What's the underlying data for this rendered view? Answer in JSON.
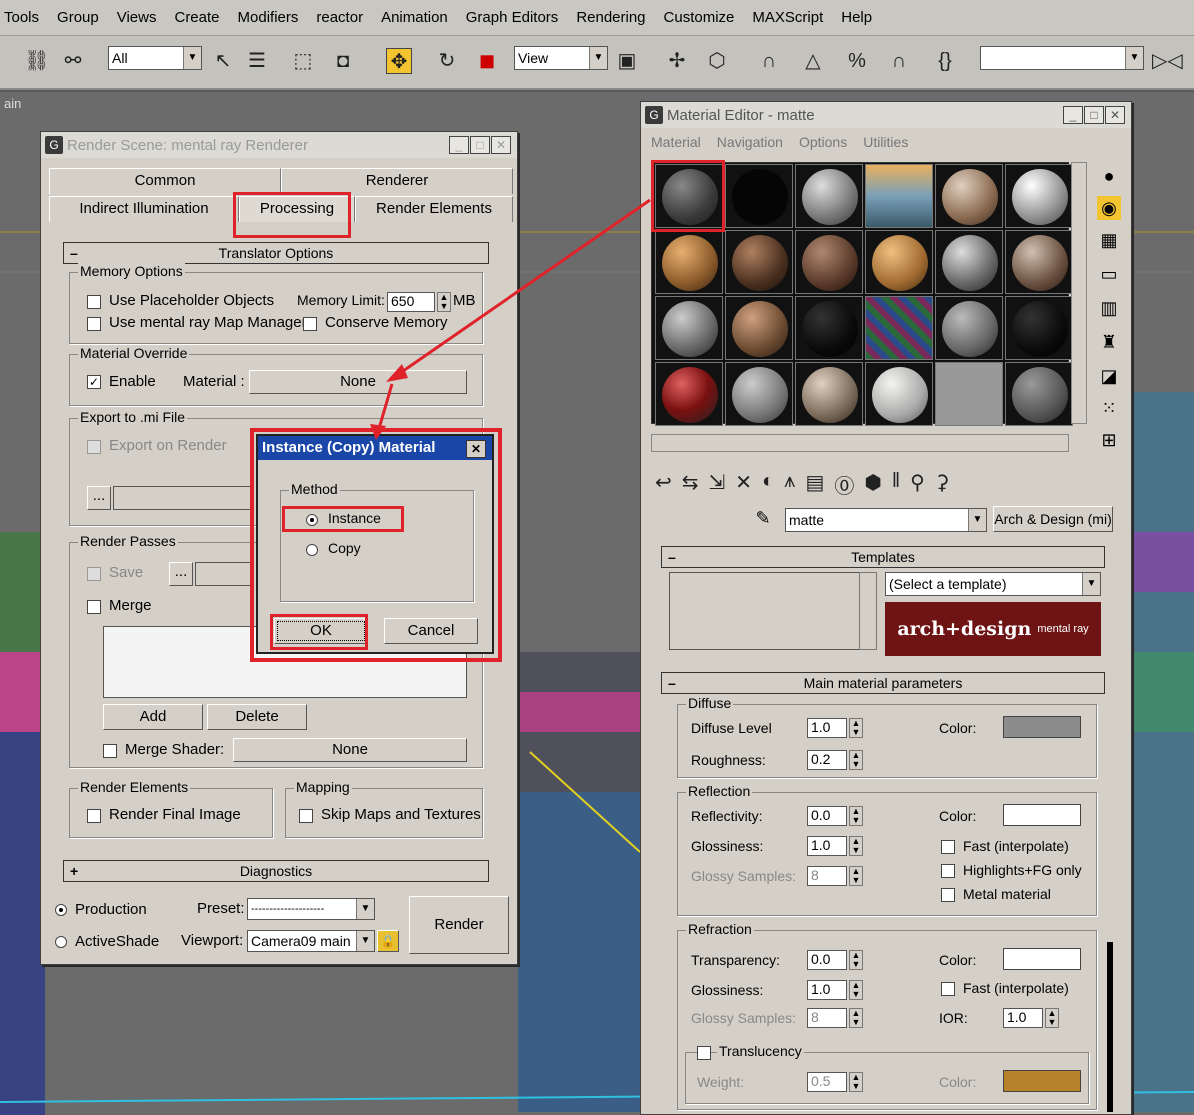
{
  "menubar": {
    "items": [
      "Tools",
      "Group",
      "Views",
      "Create",
      "Modifiers",
      "reactor",
      "Animation",
      "Graph Editors",
      "Rendering",
      "Customize",
      "MAXScript",
      "Help"
    ]
  },
  "toolbar": {
    "selection_filter": "All",
    "ref_coord": "View",
    "named_sel": ""
  },
  "viewport": {
    "label": "ain"
  },
  "render_scene": {
    "title": "Render Scene: mental ray Renderer",
    "tabs_row1": [
      "Common",
      "Renderer"
    ],
    "tabs_row2": [
      "Indirect Illumination",
      "Processing",
      "Render Elements"
    ],
    "active_tab": "Processing",
    "translator_rollout": "Translator Options",
    "memory_options": {
      "label": "Memory Options",
      "use_placeholder": "Use Placeholder Objects",
      "memory_limit_label": "Memory Limit:",
      "memory_limit": "650",
      "mb": "MB",
      "use_map_manager": "Use mental ray Map Manager",
      "conserve_memory": "Conserve Memory"
    },
    "material_override": {
      "label": "Material Override",
      "enable": "Enable",
      "enable_checked": true,
      "material_label": "Material :",
      "material_value": "None"
    },
    "export_mi": {
      "label": "Export to .mi File",
      "export_on_render": "Export on Render",
      "browse": "..."
    },
    "render_passes": {
      "label": "Render Passes",
      "save": "Save",
      "browse": "...",
      "merge": "Merge",
      "add": "Add",
      "delete": "Delete",
      "merge_shader": "Merge Shader:",
      "merge_shader_value": "None"
    },
    "render_elements": {
      "label": "Render Elements",
      "render_final": "Render Final Image"
    },
    "mapping": {
      "label": "Mapping",
      "skip_maps": "Skip Maps and Textures"
    },
    "diagnostics_rollout": "Diagnostics",
    "bottom": {
      "production": "Production",
      "activeshade": "ActiveShade",
      "preset_label": "Preset:",
      "preset_value": "--------------------",
      "viewport_label": "Viewport:",
      "viewport_value": "Camera09 main",
      "render_button": "Render"
    }
  },
  "instance_dialog": {
    "title": "Instance (Copy) Material",
    "method_label": "Method",
    "instance": "Instance",
    "copy": "Copy",
    "ok": "OK",
    "cancel": "Cancel"
  },
  "material_editor": {
    "title": "Material Editor - matte",
    "menu": [
      "Material",
      "Navigation",
      "Options",
      "Utilities"
    ],
    "material_name": "matte",
    "material_type": "Arch & Design (mi)",
    "templates_rollout": "Templates",
    "template_select": "(Select a template)",
    "banner_main": "arch+design",
    "banner_sub": "mental ray",
    "main_params_rollout": "Main material parameters",
    "diffuse": {
      "label": "Diffuse",
      "level_label": "Diffuse Level",
      "level": "1.0",
      "roughness_label": "Roughness:",
      "roughness": "0.2",
      "color_label": "Color:",
      "color": "#8c8c8c"
    },
    "reflection": {
      "label": "Reflection",
      "reflectivity_label": "Reflectivity:",
      "reflectivity": "0.0",
      "glossiness_label": "Glossiness:",
      "glossiness": "1.0",
      "samples_label": "Glossy Samples:",
      "samples": "8",
      "color_label": "Color:",
      "color": "#ffffff",
      "fast_interp": "Fast (interpolate)",
      "highlights": "Highlights+FG only",
      "metal": "Metal material"
    },
    "refraction": {
      "label": "Refraction",
      "transparency_label": "Transparency:",
      "transparency": "0.0",
      "glossiness_label": "Glossiness:",
      "glossiness": "1.0",
      "samples_label": "Glossy Samples:",
      "samples": "8",
      "color_label": "Color:",
      "color": "#ffffff",
      "fast_interp": "Fast (interpolate)",
      "ior_label": "IOR:",
      "ior": "1.0",
      "translucency": "Translucency",
      "weight_label": "Weight:",
      "weight": "0.5",
      "weight_color_label": "Color:",
      "weight_color": "#b8822a"
    }
  }
}
